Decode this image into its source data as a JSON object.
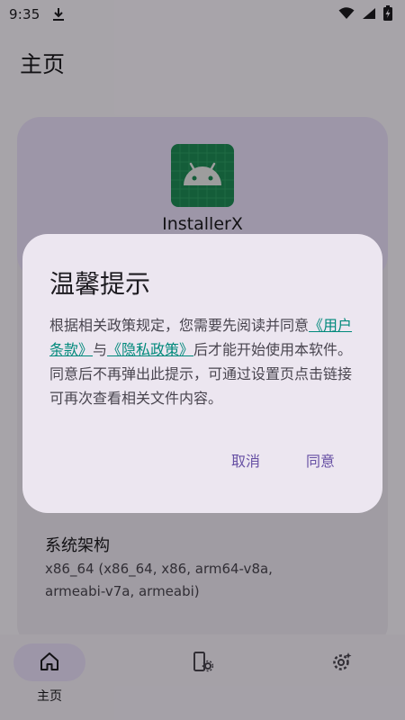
{
  "status_bar": {
    "time": "9:35",
    "icons": [
      "download-icon",
      "wifi-icon",
      "signal-icon",
      "battery-charging-icon"
    ]
  },
  "app_bar": {
    "title": "主页"
  },
  "card": {
    "app_name": "InstallerX",
    "app_icon": "android-icon",
    "info_label": "系统架构",
    "info_value": "x86_64 (x86_64, x86, arm64-v8a, armeabi-v7a, armeabi)"
  },
  "dialog": {
    "title": "温馨提示",
    "body_prefix": "根据相关政策规定，您需要先阅读并同意",
    "link_terms": "《用户条款》",
    "body_and": "与",
    "link_privacy": "《隐私政策》",
    "body_suffix": "后才能开始使用本软件。 同意后不再弹出此提示，可通过设置页点击链接可再次查看相关文件内容。",
    "cancel_label": "取消",
    "agree_label": "同意"
  },
  "bottom_nav": {
    "items": [
      {
        "label": "主页",
        "icon": "home-icon",
        "selected": true
      },
      {
        "label": "",
        "icon": "installer-settings-icon"
      },
      {
        "label": "",
        "icon": "settings-gear-icon"
      }
    ]
  },
  "colors": {
    "link": "#00897b",
    "primary": "#6750a4",
    "app_icon_bg": "#1e8a55"
  }
}
